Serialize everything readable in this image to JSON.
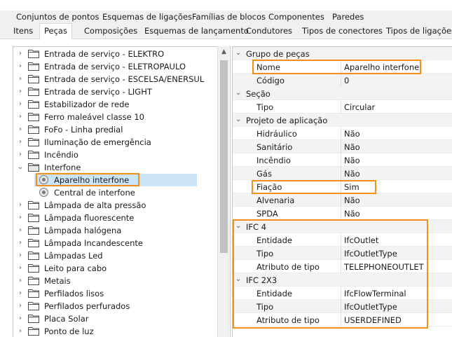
{
  "top_tabs": [
    "Conjuntos de pontos",
    "Esquemas de ligações",
    "Famílias de blocos",
    "Componentes",
    "Paredes"
  ],
  "sub_tabs": [
    {
      "label": "Itens",
      "active": false
    },
    {
      "label": "Peças",
      "active": true
    },
    {
      "label": "Composições",
      "active": false
    },
    {
      "label": "Esquemas de lançamento",
      "active": false
    },
    {
      "label": "Condutores",
      "active": false
    },
    {
      "label": "Tipos de conectores",
      "active": false
    },
    {
      "label": "Tipos de ligações",
      "active": false
    }
  ],
  "tree": [
    {
      "label": "Entrada de serviço - ELEKTRO",
      "kind": "folder",
      "expanded": false
    },
    {
      "label": "Entrada de serviço - ELETROPAULO",
      "kind": "folder",
      "expanded": false
    },
    {
      "label": "Entrada de serviço - ESCELSA/ENERSUL",
      "kind": "folder",
      "expanded": false
    },
    {
      "label": "Entrada de serviço - LIGHT",
      "kind": "folder",
      "expanded": false
    },
    {
      "label": "Estabilizador de rede",
      "kind": "folder",
      "expanded": false
    },
    {
      "label": "Ferro maleável classe 10",
      "kind": "folder",
      "expanded": false
    },
    {
      "label": "FoFo - Linha predial",
      "kind": "folder",
      "expanded": false
    },
    {
      "label": "Iluminação de emergência",
      "kind": "folder",
      "expanded": false
    },
    {
      "label": "Incêndio",
      "kind": "folder",
      "expanded": false
    },
    {
      "label": "Interfone",
      "kind": "folder",
      "expanded": true
    },
    {
      "label": "Aparelho interfone",
      "kind": "item",
      "selected": true
    },
    {
      "label": "Central de interfone",
      "kind": "item",
      "selected": false
    },
    {
      "label": "Lâmpada de alta pressão",
      "kind": "folder",
      "expanded": false
    },
    {
      "label": "Lâmpada fluorescente",
      "kind": "folder",
      "expanded": false
    },
    {
      "label": "Lâmpada halógena",
      "kind": "folder",
      "expanded": false
    },
    {
      "label": "Lâmpada Incandescente",
      "kind": "folder",
      "expanded": false
    },
    {
      "label": "Lâmpadas Led",
      "kind": "folder",
      "expanded": false
    },
    {
      "label": "Leito para cabo",
      "kind": "folder",
      "expanded": false
    },
    {
      "label": "Metais",
      "kind": "folder",
      "expanded": false
    },
    {
      "label": "Perfilados lisos",
      "kind": "folder",
      "expanded": false
    },
    {
      "label": "Perfilados perfurados",
      "kind": "folder",
      "expanded": false
    },
    {
      "label": "Placa Solar",
      "kind": "folder",
      "expanded": false
    },
    {
      "label": "Ponto de luz",
      "kind": "folder",
      "expanded": false
    }
  ],
  "properties": [
    {
      "type": "category",
      "label": "Grupo de peças"
    },
    {
      "type": "prop",
      "name": "Nome",
      "value": "Aparelho interfone"
    },
    {
      "type": "prop",
      "name": "Código",
      "value": "0"
    },
    {
      "type": "category",
      "label": "Seção"
    },
    {
      "type": "prop",
      "name": "Tipo",
      "value": "Circular"
    },
    {
      "type": "category",
      "label": "Projeto de aplicação"
    },
    {
      "type": "prop",
      "name": "Hidráulico",
      "value": "Não"
    },
    {
      "type": "prop",
      "name": "Sanitário",
      "value": "Não"
    },
    {
      "type": "prop",
      "name": "Incêndio",
      "value": "Não"
    },
    {
      "type": "prop",
      "name": "Gás",
      "value": "Não"
    },
    {
      "type": "prop",
      "name": "Fiação",
      "value": "Sim"
    },
    {
      "type": "prop",
      "name": "Alvenaria",
      "value": "Não"
    },
    {
      "type": "prop",
      "name": "SPDA",
      "value": "Não"
    },
    {
      "type": "category",
      "label": "IFC 4"
    },
    {
      "type": "prop",
      "name": "Entidade",
      "value": "IfcOutlet"
    },
    {
      "type": "prop",
      "name": "Tipo",
      "value": "IfcOutletType"
    },
    {
      "type": "prop",
      "name": "Atributo de tipo",
      "value": "TELEPHONEOUTLET"
    },
    {
      "type": "category",
      "label": "IFC 2X3"
    },
    {
      "type": "prop",
      "name": "Entidade",
      "value": "IfcFlowTerminal"
    },
    {
      "type": "prop",
      "name": "Tipo",
      "value": "IfcOutletType"
    },
    {
      "type": "prop",
      "name": "Atributo de tipo",
      "value": "USERDEFINED"
    }
  ],
  "colors": {
    "highlight": "#f39019",
    "selection": "#cce4f7"
  }
}
